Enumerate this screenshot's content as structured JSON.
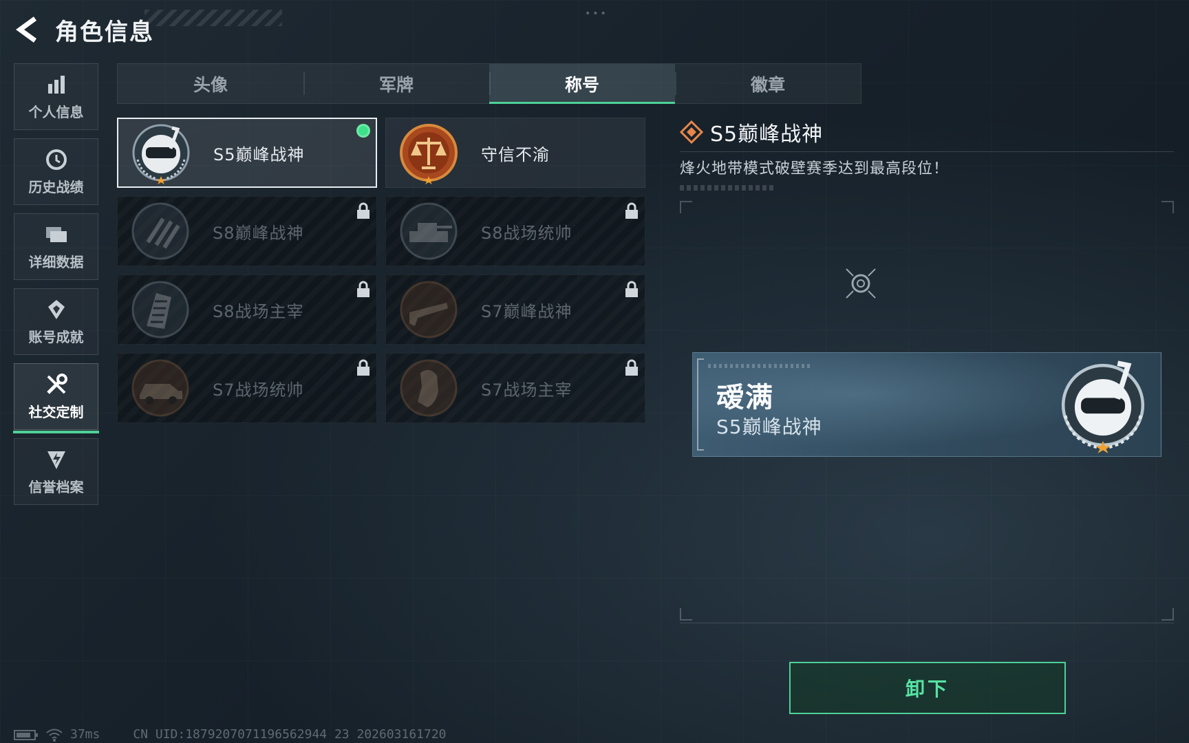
{
  "header": {
    "title": "角色信息"
  },
  "sidebar": {
    "items": [
      {
        "label": "个人信息",
        "icon": "bar-chart-icon"
      },
      {
        "label": "历史战绩",
        "icon": "history-icon"
      },
      {
        "label": "详细数据",
        "icon": "folder-icon"
      },
      {
        "label": "账号成就",
        "icon": "achievement-icon"
      },
      {
        "label": "社交定制",
        "icon": "tools-icon",
        "active": true
      },
      {
        "label": "信誉档案",
        "icon": "credit-shield-icon"
      }
    ]
  },
  "tabs": [
    {
      "label": "头像"
    },
    {
      "label": "军牌"
    },
    {
      "label": "称号",
      "active": true
    },
    {
      "label": "徽章"
    }
  ],
  "titles": [
    {
      "name": "S5巅峰战神",
      "state": "equipped"
    },
    {
      "name": "守信不渝",
      "state": "unlocked"
    },
    {
      "name": "S8巅峰战神",
      "state": "locked"
    },
    {
      "name": "S8战场统帅",
      "state": "locked"
    },
    {
      "name": "S8战场主宰",
      "state": "locked"
    },
    {
      "name": "S7巅峰战神",
      "state": "locked"
    },
    {
      "name": "S7战场统帅",
      "state": "locked"
    },
    {
      "name": "S7战场主宰",
      "state": "locked"
    }
  ],
  "detail": {
    "title": "S5巅峰战神",
    "description": "烽火地带模式破壁赛季达到最高段位！"
  },
  "name_card": {
    "player_name": "叆满",
    "player_title": "S5巅峰战神"
  },
  "actions": {
    "unequip_label": "卸下"
  },
  "status": {
    "ping": "37ms",
    "uid": "CN UID:1879207071196562944 23 202603161720"
  },
  "colors": {
    "accent_green": "#4fd198",
    "equipped_dot": "#3fe08a",
    "detail_icon": "#e8864a"
  }
}
